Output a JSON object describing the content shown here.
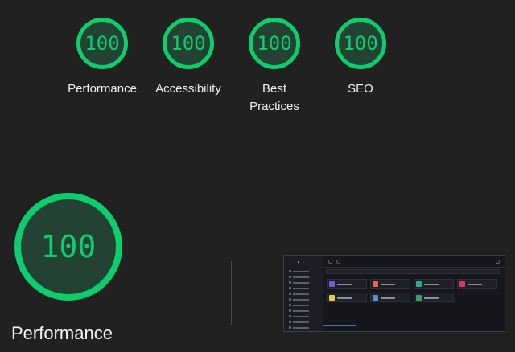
{
  "summary": {
    "gauges": [
      {
        "score": "100",
        "label": "Performance"
      },
      {
        "score": "100",
        "label": "Accessibility"
      },
      {
        "score": "100",
        "label": "Best Practices"
      },
      {
        "score": "100",
        "label": "SEO"
      }
    ]
  },
  "detail": {
    "score": "100",
    "title": "Performance"
  },
  "colors": {
    "pass_green": "#0cce6b",
    "gauge_fill": "#234233",
    "background": "#212121"
  },
  "thumbnail": {
    "description_icon": "page-screenshot",
    "card_colors": [
      "#6f5fd6",
      "#e2664f",
      "#2fa79a",
      "#d83a67",
      "#e8c940",
      "#5a8fd6",
      "#3f9f6b"
    ]
  }
}
